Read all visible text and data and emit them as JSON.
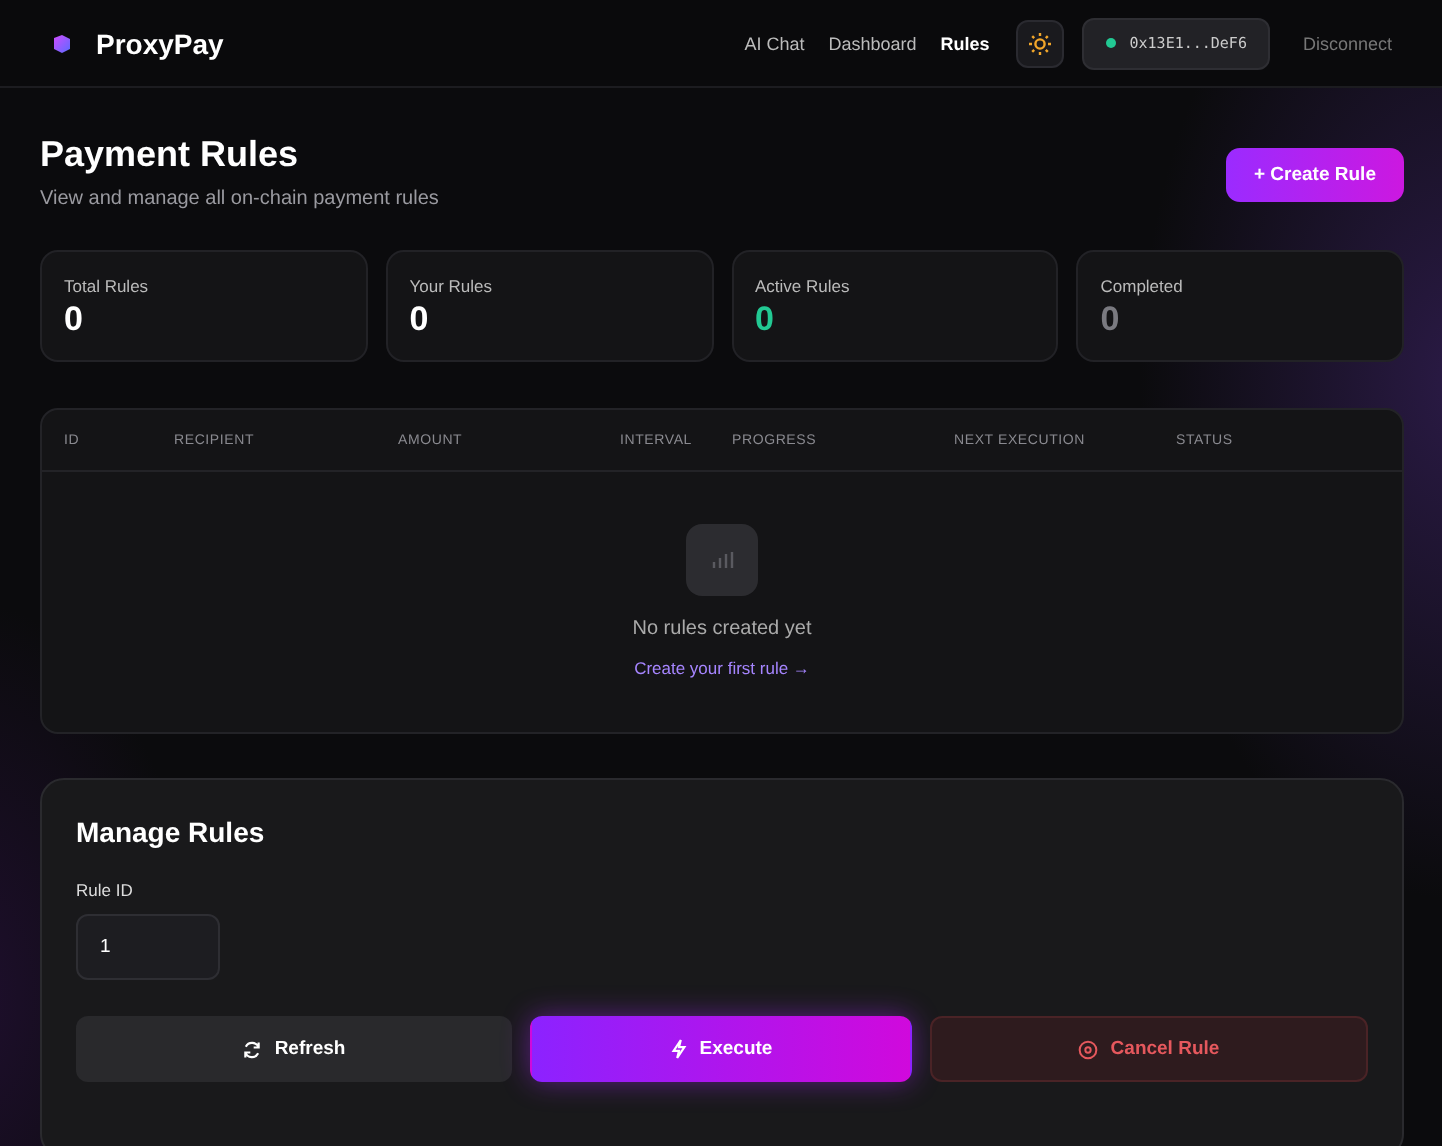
{
  "brand": {
    "name": "ProxyPay"
  },
  "nav": [
    {
      "label": "AI Chat",
      "selected": false
    },
    {
      "label": "Dashboard",
      "selected": false
    },
    {
      "label": "Rules",
      "selected": true
    }
  ],
  "wallet": {
    "address": "0x13E1...DeF6",
    "connected": true
  },
  "disconnect": "Disconnect",
  "header": {
    "title": "Payment Rules",
    "subtitle": "View and manage all on-chain payment rules",
    "create_button": "+ Create Rule"
  },
  "stats": [
    {
      "label": "Total Rules",
      "value": "0",
      "color": "#ffffff"
    },
    {
      "label": "Your Rules",
      "value": "0",
      "color": "#ffffff"
    },
    {
      "label": "Active Rules",
      "value": "0",
      "color": "#22c993"
    },
    {
      "label": "Completed",
      "value": "0",
      "color": "#7a7a80"
    }
  ],
  "table": {
    "columns": [
      "ID",
      "RECIPIENT",
      "AMOUNT",
      "INTERVAL",
      "PROGRESS",
      "NEXT EXECUTION",
      "STATUS"
    ],
    "empty_text": "No rules created yet",
    "empty_link": "Create your first rule →"
  },
  "manage": {
    "title": "Manage Rules",
    "field_label": "Rule ID",
    "field_value": "1",
    "buttons": [
      {
        "label": "Refresh",
        "kind": "secondary"
      },
      {
        "label": "Execute",
        "kind": "primary"
      },
      {
        "label": "Cancel Rule",
        "kind": "danger"
      }
    ]
  }
}
